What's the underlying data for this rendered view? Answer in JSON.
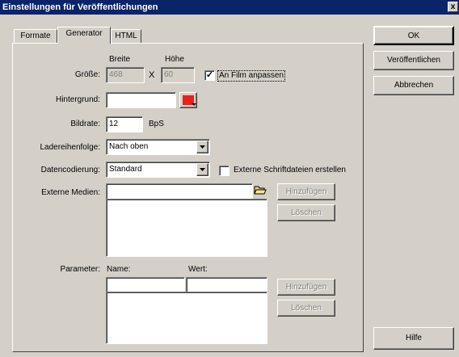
{
  "window": {
    "title": "Einstellungen für Veröffentlichungen",
    "close_glyph": "x"
  },
  "tabs": [
    {
      "label": "Formate",
      "active": false
    },
    {
      "label": "Generator",
      "active": true
    },
    {
      "label": "HTML",
      "active": false
    }
  ],
  "generator": {
    "size": {
      "label": "Größe:",
      "width_label": "Breite",
      "height_label": "Höhe",
      "separator": "X",
      "width_value": "468",
      "height_value": "60",
      "fit_checkbox_label": "An Film anpassen",
      "fit_checked": true
    },
    "background": {
      "label": "Hintergrund:",
      "value": "",
      "color": "#e8221b"
    },
    "framerate": {
      "label": "Bildrate:",
      "value": "12",
      "unit": "BpS"
    },
    "load_order": {
      "label": "Ladereihenfolge:",
      "value": "Nach oben"
    },
    "encoding": {
      "label": "Datencodierung:",
      "value": "Standard",
      "external_fonts_label": "Externe Schriftdateien erstellen",
      "external_fonts_checked": false
    },
    "external_media": {
      "label": "Externe Medien:",
      "value": "",
      "add_label": "Hinzufügen",
      "delete_label": "Löschen"
    },
    "parameters": {
      "label": "Parameter:",
      "name_header": "Name:",
      "value_header": "Wert:",
      "add_label": "Hinzufügen",
      "delete_label": "Löschen"
    }
  },
  "side_buttons": {
    "ok": "OK",
    "publish": "Veröffentlichen",
    "cancel": "Abbrechen",
    "help": "Hilfe"
  }
}
